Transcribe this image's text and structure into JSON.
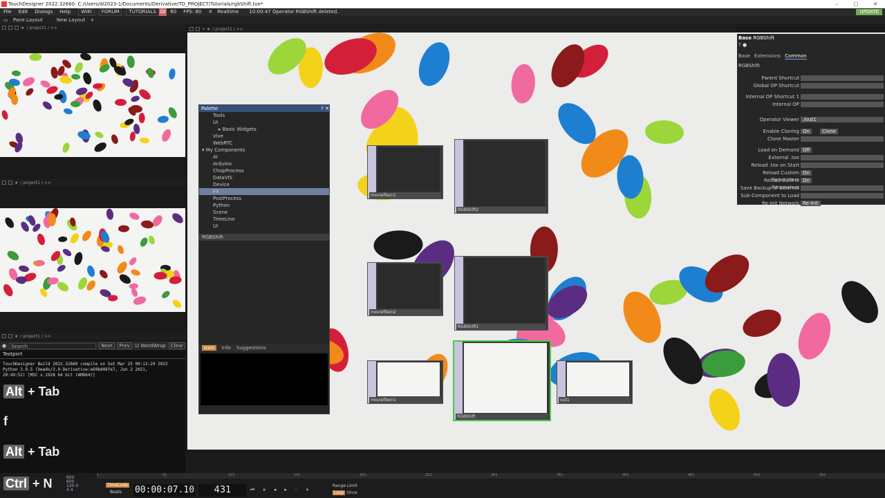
{
  "titlebar": {
    "text": "TouchDesigner 2022.32660: C:/Users/di2023-1/Documents/Derivative/TD_PROJECT/Tutorials/rgbShift.toe*"
  },
  "menu": {
    "items": [
      "File",
      "Edit",
      "Dialogs",
      "Help"
    ],
    "wiki": "WIKI",
    "forum": "FORUM",
    "tutorials": "TUTORIALS",
    "oi": "OI",
    "fps_a": "60",
    "fps_b": "FPS: 60",
    "realtime": "Realtime",
    "status": "10:00:47 Operator RGBShift deleted.",
    "update": "UPDATE"
  },
  "panebar": {
    "pane_layout": "Pane Layout",
    "new_layout": "New Layout"
  },
  "path": {
    "path": "/ project1 / >>"
  },
  "palette": {
    "title": "Palette",
    "items": [
      "Tools",
      "UI",
      "Basic Widgets",
      "Vive",
      "WebRTC",
      "My Components",
      "AI",
      "Arduino",
      "ChopProcess",
      "DataVIS",
      "Device",
      "FX",
      "PostProcess",
      "Python",
      "Scene",
      "TimeLine",
      "UI"
    ],
    "selected": "RGBShift",
    "tabs": [
      "Icon",
      "Info",
      "Suggestions"
    ]
  },
  "nodes": [
    {
      "label": "moviefilein1"
    },
    {
      "label": "RGBShift2"
    },
    {
      "label": "moviefilein2"
    },
    {
      "label": "RGBShift1"
    },
    {
      "label": "moviefilein1"
    },
    {
      "label": "RGBShift"
    },
    {
      "label": "out1"
    }
  ],
  "params": {
    "header": "Base",
    "name": "RGBShift",
    "tabs": [
      "Base",
      "Extensions",
      "Common"
    ],
    "section": "RGBShift",
    "rows": [
      {
        "k": "Parent Shortcut",
        "v": ""
      },
      {
        "k": "Global OP Shortcut",
        "v": ""
      },
      {
        "k": "Internal OP Shortcut 1",
        "v": ""
      },
      {
        "k": "Internal OP",
        "v": ""
      },
      {
        "k": "Operator Viewer",
        "v": "./out1"
      },
      {
        "k": "Enable Cloning",
        "v": "On",
        "extra": "Clone"
      },
      {
        "k": "Clone Master",
        "v": ""
      },
      {
        "k": "Load on Demand",
        "v": "Off"
      },
      {
        "k": "External .tox",
        "v": ""
      },
      {
        "k": "Reload .tox on Start",
        "v": ""
      },
      {
        "k": "Reload Custom Parameters",
        "v": "On"
      },
      {
        "k": "Reload Built-In Parameters",
        "v": "On"
      },
      {
        "k": "Save Backup of External",
        "v": ""
      },
      {
        "k": "Sub-Component to Load",
        "v": ""
      },
      {
        "k": "Re-Init Network",
        "v": "Re-Init"
      }
    ]
  },
  "textport": {
    "search": "Search",
    "next": "Next",
    "prev": "Prev",
    "wordwrap": "WordWrap",
    "clear": "Clear",
    "tab": "Textport",
    "lines": [
      "TouchDesigner  Build 2022.32660 compile on Sat Mar 25 09:13:29 2023",
      "Python 3.9.5 (heads/3.9-Derivative:e69bd46fe7, Jun  2 2021,",
      "20:49:52) [MSC v.1928 64 bit (AMD64)]"
    ]
  },
  "keys": {
    "alt": "Alt",
    "plus": "+",
    "tab": "Tab",
    "f": "f",
    "ctrl": "Ctrl",
    "n": "N"
  },
  "timeline": {
    "timecode_label": "TimeCode",
    "beats_label": "Beats",
    "timecode": "00:00:07.10",
    "frame": "431",
    "range_label": "Range Limit",
    "loop": "Loop",
    "once": "Once",
    "ruler": [
      "1",
      "51",
      "101",
      "151",
      "201",
      "251",
      "301",
      "351",
      "401",
      "451",
      "501",
      "551"
    ],
    "stats": [
      "600",
      "600",
      "120.0",
      "4    4"
    ]
  }
}
